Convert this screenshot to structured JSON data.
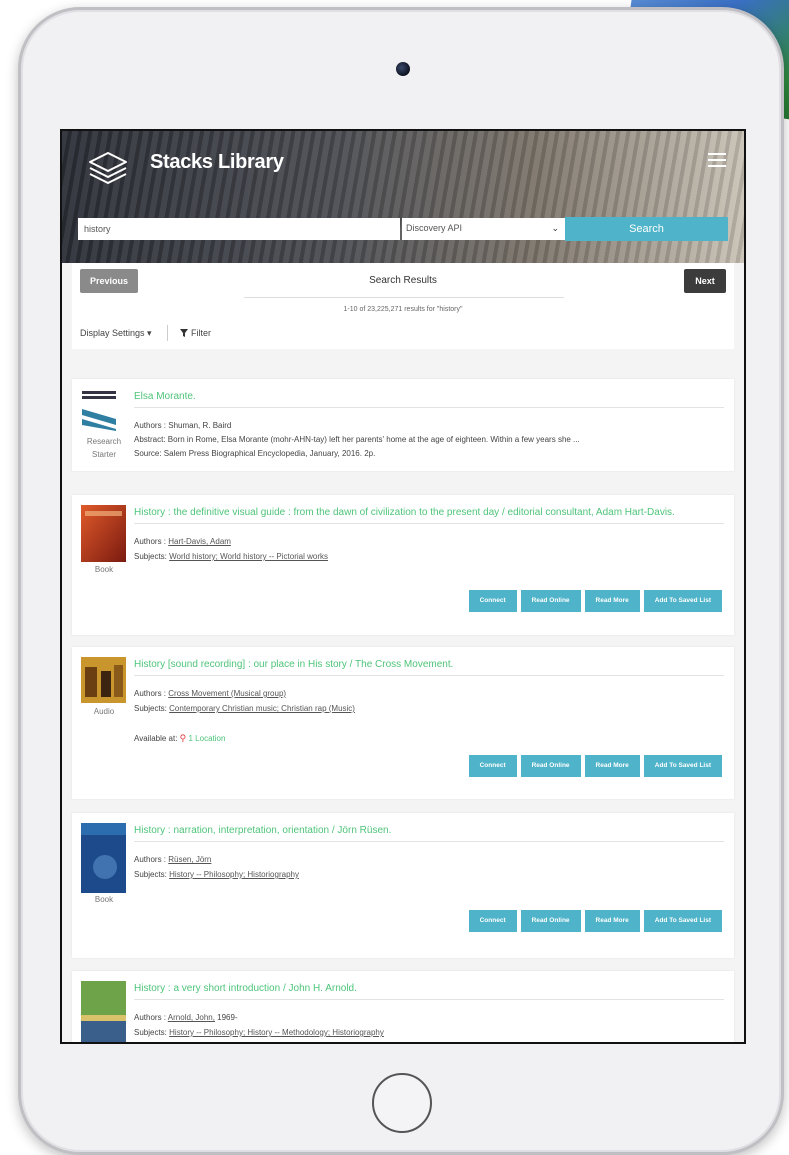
{
  "app": {
    "title": "Stacks Library"
  },
  "search": {
    "query": "history",
    "source": "Discovery API",
    "button": "Search"
  },
  "results": {
    "previous": "Previous",
    "next": "Next",
    "heading": "Search Results",
    "count": "1-10 of 23,225,271 results for \"history\"",
    "display_settings": "Display Settings ▾",
    "filter": "Filter"
  },
  "actions": {
    "connect": "Connect",
    "read_online": "Read Online",
    "read_more": "Read More",
    "save": "Add To Saved List"
  },
  "items": [
    {
      "title": "Elsa Morante.",
      "type_line1": "Research",
      "type_line2": "Starter",
      "authors": "Authors : Shuman, R. Baird",
      "abstract": "Abstract: Born in Rome, Elsa Morante (mohr-AHN-tay) left her parents' home at the age of eighteen. Within a few years she ...",
      "source": "Source: Salem Press Biographical Encyclopedia, January, 2016. 2p."
    },
    {
      "title": "History : the definitive visual guide : from the dawn of civilization to the present day / editorial consultant, Adam Hart-Davis.",
      "type": "Book",
      "authors_label": "Authors : ",
      "authors": "Hart-Davis, Adam",
      "subjects_label": "Subjects: ",
      "subjects": "World history; World history -- Pictorial works"
    },
    {
      "title": "History [sound recording] : our place in His story / The Cross Movement.",
      "type": "Audio",
      "authors_label": "Authors : ",
      "authors": "Cross Movement (Musical group)",
      "subjects_label": "Subjects: ",
      "subjects": "Contemporary Christian music; Christian rap (Music)",
      "available_label": "Available at: ",
      "available": "1 Location"
    },
    {
      "title": "History : narration, interpretation, orientation / Jörn Rüsen.",
      "type": "Book",
      "authors_label": "Authors : ",
      "authors": "Rüsen, Jörn",
      "subjects_label": "Subjects: ",
      "subjects": "History -- Philosophy; Historiography"
    },
    {
      "title": "History : a very short introduction / John H. Arnold.",
      "authors_label": "Authors : ",
      "authors": "Arnold, John,",
      "authors_suffix": " 1969-",
      "subjects_label": "Subjects: ",
      "subjects": "History -- Philosophy; History -- Methodology; Historiography"
    }
  ]
}
